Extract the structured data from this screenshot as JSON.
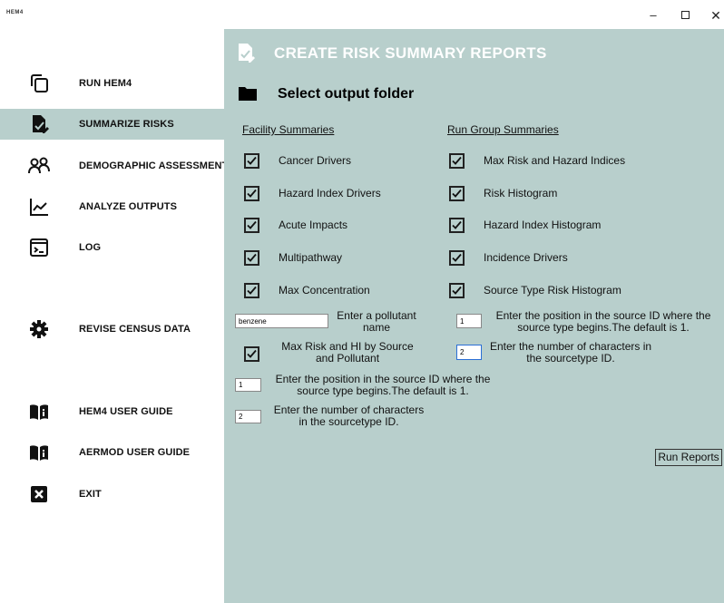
{
  "window": {
    "title": "HEM4",
    "minimize_glyph": "–",
    "close_glyph": "✕"
  },
  "sidebar": {
    "items": [
      {
        "label": "RUN HEM4",
        "icon": "copy-icon"
      },
      {
        "label": "SUMMARIZE RISKS",
        "icon": "edit-document-icon",
        "active": true
      },
      {
        "label": "DEMOGRAPHIC ASSESSMENT",
        "icon": "people-icon"
      },
      {
        "label": "ANALYZE OUTPUTS",
        "icon": "line-chart-icon"
      },
      {
        "label": "LOG",
        "icon": "terminal-icon"
      },
      {
        "label": "REVISE CENSUS DATA",
        "icon": "gear-icon"
      },
      {
        "label": "HEM4 USER GUIDE",
        "icon": "book-icon"
      },
      {
        "label": "AERMOD USER GUIDE",
        "icon": "book-icon"
      },
      {
        "label": "EXIT",
        "icon": "close-box-icon"
      }
    ]
  },
  "main": {
    "title": "CREATE RISK SUMMARY REPORTS",
    "select_folder": "Select output folder",
    "facility": {
      "heading": "Facility Summaries",
      "items": [
        "Cancer Drivers",
        "Hazard Index Drivers",
        "Acute Impacts",
        "Multipathway",
        "Max Concentration"
      ],
      "pollutant_value": "benzene",
      "pollutant_label": "Enter a pollutant name",
      "max_risk_label": "Max Risk and HI by Source and Pollutant",
      "position_value": "1",
      "position_label": "Enter the position in the source ID where the source type begins.The default is 1.",
      "chars_value": "2",
      "chars_label": "Enter the number of characters in the sourcetype ID."
    },
    "rungroup": {
      "heading": "Run Group Summaries",
      "items": [
        "Max Risk and Hazard Indices",
        "Risk Histogram",
        "Hazard Index Histogram",
        "Incidence Drivers",
        "Source Type Risk Histogram"
      ],
      "position_value": "1",
      "position_label": "Enter the position in the source ID where the source type begins.The default is 1.",
      "chars_value": "2",
      "chars_label": "Enter the number of characters in the sourcetype ID."
    },
    "run_button": "Run Reports"
  },
  "colors": {
    "panel": "#b8cfcc",
    "active_nav": "#b8cfcc",
    "header_text": "#ffffff"
  }
}
